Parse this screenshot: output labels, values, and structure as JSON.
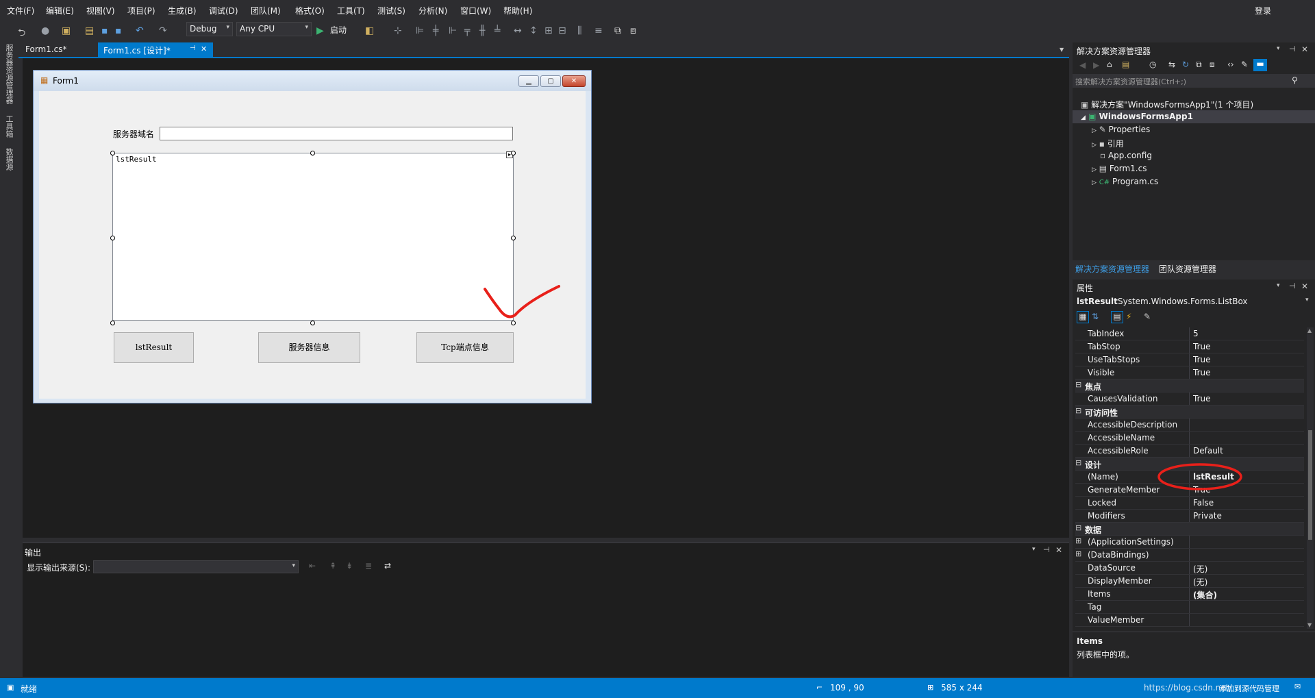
{
  "menu": [
    "文件(F)",
    "编辑(E)",
    "视图(V)",
    "项目(P)",
    "生成(B)",
    "调试(D)",
    "团队(M)",
    "格式(O)",
    "工具(T)",
    "测试(S)",
    "分析(N)",
    "窗口(W)",
    "帮助(H)"
  ],
  "login": "登录",
  "toolbar": {
    "config": "Debug",
    "platform": "Any CPU",
    "start": "启动"
  },
  "left_tabs": [
    "服务器资源管理器",
    "工具箱",
    "数据源"
  ],
  "doc_tabs": [
    {
      "label": "Form1.cs*"
    },
    {
      "label": "Form1.cs [设计]*",
      "pin": "⊣",
      "close": "✕"
    }
  ],
  "form": {
    "title": "Form1",
    "label_server": "服务器域名",
    "listbox_text": "lstResult",
    "buttons": [
      "lstResult",
      "服务器信息",
      "Tcp端点信息"
    ]
  },
  "output": {
    "title": "输出",
    "source_label": "显示输出来源(S):"
  },
  "solution": {
    "title": "解决方案资源管理器",
    "search_placeholder": "搜索解决方案资源管理器(Ctrl+;)",
    "solution_node": "解决方案\"WindowsFormsApp1\"(1 个项目)",
    "project": "WindowsFormsApp1",
    "items": [
      "Properties",
      "引用",
      "App.config",
      "Form1.cs",
      "Program.cs"
    ],
    "tabs": [
      "解决方案资源管理器",
      "团队资源管理器"
    ]
  },
  "properties": {
    "title": "属性",
    "object_name": "lstResult",
    "object_type": "System.Windows.Forms.ListBox",
    "rows": [
      {
        "name": "TabIndex",
        "value": "5"
      },
      {
        "name": "TabStop",
        "value": "True"
      },
      {
        "name": "UseTabStops",
        "value": "True"
      },
      {
        "name": "Visible",
        "value": "True"
      },
      {
        "cat": "焦点"
      },
      {
        "name": "CausesValidation",
        "value": "True"
      },
      {
        "cat": "可访问性"
      },
      {
        "name": "AccessibleDescription",
        "value": ""
      },
      {
        "name": "AccessibleName",
        "value": ""
      },
      {
        "name": "AccessibleRole",
        "value": "Default"
      },
      {
        "cat": "设计"
      },
      {
        "name": "(Name)",
        "value": "lstResult"
      },
      {
        "name": "GenerateMember",
        "value": "True"
      },
      {
        "name": "Locked",
        "value": "False"
      },
      {
        "name": "Modifiers",
        "value": "Private"
      },
      {
        "cat": "数据"
      },
      {
        "name": "(ApplicationSettings)",
        "value": "",
        "expand": true
      },
      {
        "name": "(DataBindings)",
        "value": "",
        "expand": true
      },
      {
        "name": "DataSource",
        "value": "(无)"
      },
      {
        "name": "DisplayMember",
        "value": "(无)"
      },
      {
        "name": "Items",
        "value": "(集合)"
      },
      {
        "name": "Tag",
        "value": ""
      },
      {
        "name": "ValueMember",
        "value": ""
      }
    ],
    "desc_title": "Items",
    "desc_text": "列表框中的项。"
  },
  "status": {
    "ready": "就绪",
    "position": "109 , 90",
    "size": "585 x 244",
    "watermark": "https://blog.csdn.net/",
    "right": "添加到源代码管理"
  }
}
